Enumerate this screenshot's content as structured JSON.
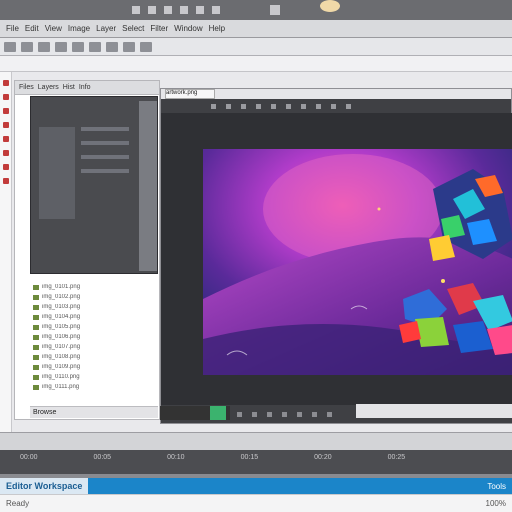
{
  "titlebar": {
    "icon": "app-logo-icon"
  },
  "menubar": {
    "items": [
      "File",
      "Edit",
      "View",
      "Image",
      "Layer",
      "Select",
      "Filter",
      "Window",
      "Help"
    ]
  },
  "leftpanel": {
    "tabs": [
      "Files",
      "Layers",
      "Hist",
      "Info"
    ],
    "list": [
      "img_0101.png",
      "img_0102.png",
      "img_0103.png",
      "img_0104.png",
      "img_0105.png",
      "img_0106.png",
      "img_0107.png",
      "img_0108.png",
      "img_0109.png",
      "img_0110.png",
      "img_0111.png"
    ],
    "footer": "Browse"
  },
  "document": {
    "tab_label": "artwork.png"
  },
  "timeline": {
    "labels": [
      "00:00",
      "00:05",
      "00:10",
      "00:15",
      "00:20",
      "00:25"
    ]
  },
  "taskbar": {
    "left_label": "Editor Workspace",
    "right_label": "Tools"
  },
  "statusline": {
    "left": "Ready",
    "right": "100%"
  },
  "colors": {
    "accent": "#1b85c9",
    "canvas_bg": "#2f3034",
    "swatch": "#3bb36e"
  }
}
